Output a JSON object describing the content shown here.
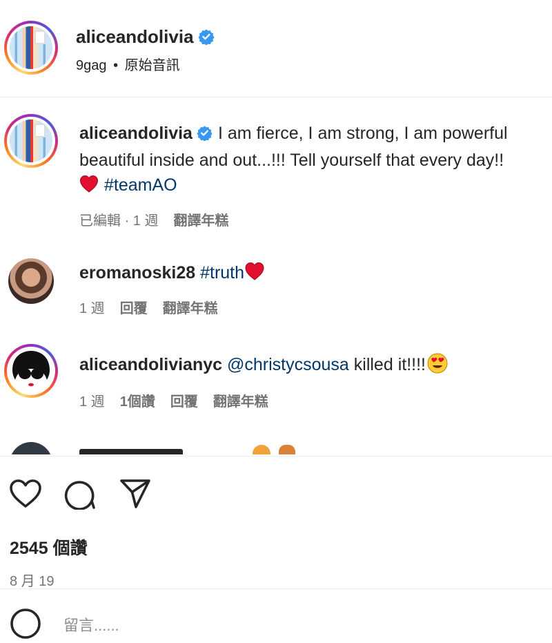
{
  "header": {
    "username": "aliceandolivia",
    "sub_account": "9gag",
    "separator": "•",
    "audio": "原始音訊"
  },
  "caption": {
    "username": "aliceandolivia",
    "line1": "I am fierce, I am strong, I am powerful",
    "line2": "beautiful inside and out...!!! Tell yourself that every day!!",
    "hashtag": "#teamAO",
    "edited": "已編輯",
    "dot": "·",
    "time": "1 週",
    "translate": "翻譯年糕"
  },
  "comments": [
    {
      "username": "eromanoski28",
      "hashtag": "#truth",
      "time": "1 週",
      "reply": "回覆",
      "translate": "翻譯年糕"
    },
    {
      "username": "aliceandolivianyc",
      "mention": "@christycsousa",
      "text": " killed it!!!!",
      "time": "1 週",
      "likes": "1個讚",
      "reply": "回覆",
      "translate": "翻譯年糕"
    }
  ],
  "actions": {
    "like_icon": "heart-icon",
    "comment_icon": "comment-bubble-icon",
    "share_icon": "paper-plane-icon"
  },
  "stats": {
    "likes_count": "2545",
    "likes_label": "個讚",
    "date": "8 月 19"
  },
  "composer": {
    "placeholder": "留言......"
  },
  "colors": {
    "verified": "#3897f0",
    "hashtag": "#00376b",
    "muted": "#737373",
    "heart": "#e0102e"
  }
}
